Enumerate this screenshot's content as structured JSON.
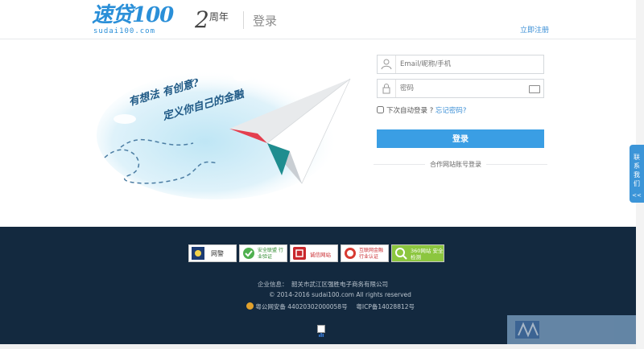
{
  "header": {
    "logo_text": "速贷100",
    "logo_domain": "sudai100.com",
    "anniversary_number": "2",
    "anniversary_text": "周年",
    "page_title": "登录",
    "register_link": "立即注册"
  },
  "illustration": {
    "slogan_line1": "有想法 有创意?",
    "slogan_line2": "定义你自己的金融"
  },
  "login_form": {
    "username_placeholder": "Email/昵称/手机",
    "password_placeholder": "密码",
    "remember_label": "下次自动登录 ?",
    "forgot_link": "忘记密码?",
    "login_button": "登录",
    "oauth_label": "合作网站账号登录"
  },
  "footer": {
    "badges": [
      "网警",
      "安全联盟 行业验证",
      "诚信网站",
      "互联网金融 行业认证",
      "360网站 安全检测"
    ],
    "company_label": "企业信息：",
    "company_name": "韶关市武江区强胜电子商务有限公司",
    "copyright": "© 2014-2016 sudai100.com All rights reserved",
    "police_record": "粤公网安备 44020302000058号",
    "icp_record": "粤ICP备14028812号"
  },
  "side_widget": {
    "contact_label": "联系我们",
    "collapse": "<<"
  },
  "colors": {
    "brand_blue": "#3a9ee4",
    "footer_bg": "#13293f",
    "link_blue": "#3b8fd6"
  }
}
